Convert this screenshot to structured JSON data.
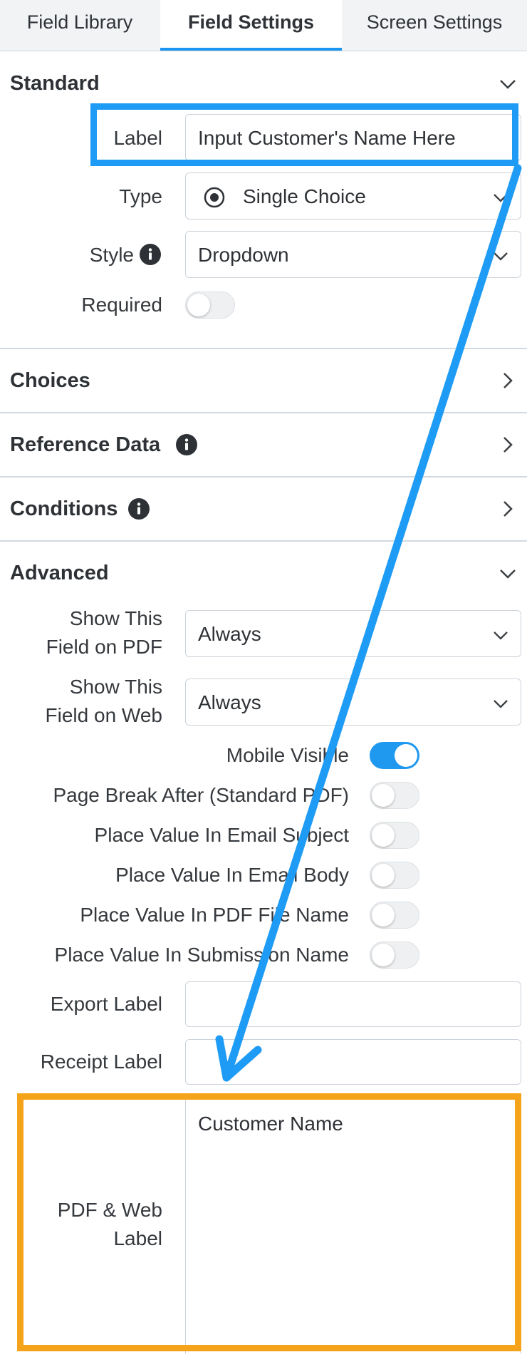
{
  "tabs": [
    {
      "label": "Field Library"
    },
    {
      "label": "Field Settings",
      "active": true
    },
    {
      "label": "Screen Settings"
    }
  ],
  "standard": {
    "title": "Standard",
    "label_label": "Label",
    "label_value": "Input Customer's Name Here",
    "type_label": "Type",
    "type_value": "Single Choice",
    "style_label": "Style",
    "style_value": "Dropdown",
    "required_label": "Required",
    "required_on": false
  },
  "sections": {
    "choices": "Choices",
    "reference_data": "Reference Data",
    "conditions": "Conditions",
    "advanced": "Advanced"
  },
  "advanced": {
    "show_pdf_label_1": "Show This",
    "show_pdf_label_2": "Field on PDF",
    "show_pdf_value": "Always",
    "show_web_label_1": "Show This",
    "show_web_label_2": "Field on Web",
    "show_web_value": "Always",
    "toggles": [
      {
        "label": "Mobile Visible",
        "on": true
      },
      {
        "label": "Page Break After (Standard PDF)",
        "on": false
      },
      {
        "label": "Place Value In Email Subject",
        "on": false
      },
      {
        "label": "Place Value In Email Body",
        "on": false
      },
      {
        "label": "Place Value In PDF File Name",
        "on": false
      },
      {
        "label": "Place Value In Submission Name",
        "on": false
      }
    ],
    "export_label": "Export Label",
    "export_value": "",
    "receipt_label": "Receipt Label",
    "receipt_value": "",
    "pdf_web_label_1": "PDF & Web",
    "pdf_web_label_2": "Label",
    "pdf_web_value": "Customer Name"
  },
  "colors": {
    "accent": "#1a96f0",
    "highlight_blue": "#1e9bf4",
    "highlight_orange": "#f5a31a"
  }
}
